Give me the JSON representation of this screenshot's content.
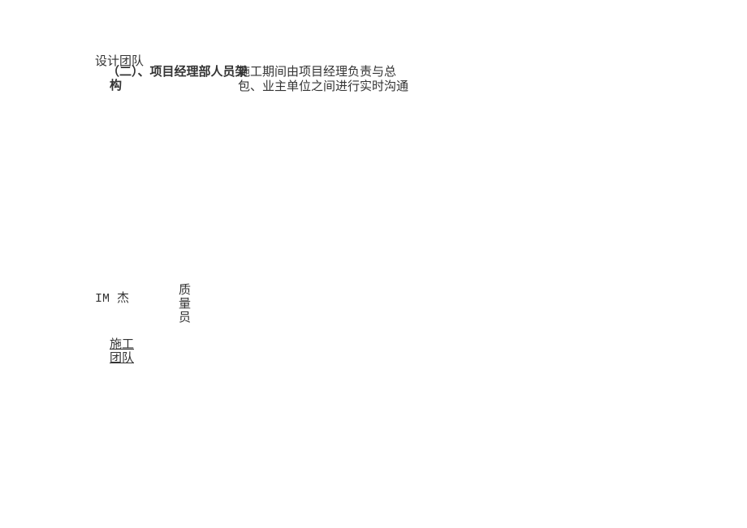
{
  "designTeam": "设计团队",
  "heading": "（二）、项目经理部人员架",
  "headingSuffix": "构",
  "bodyLine1": "施工期间由项目经理负责与总",
  "bodyLine2": "包、业主单位之间进行实时沟通",
  "imJie": "IM 杰",
  "qualityLabel": "质量员",
  "constructionTeam1": "施工",
  "constructionTeam2": "团队"
}
